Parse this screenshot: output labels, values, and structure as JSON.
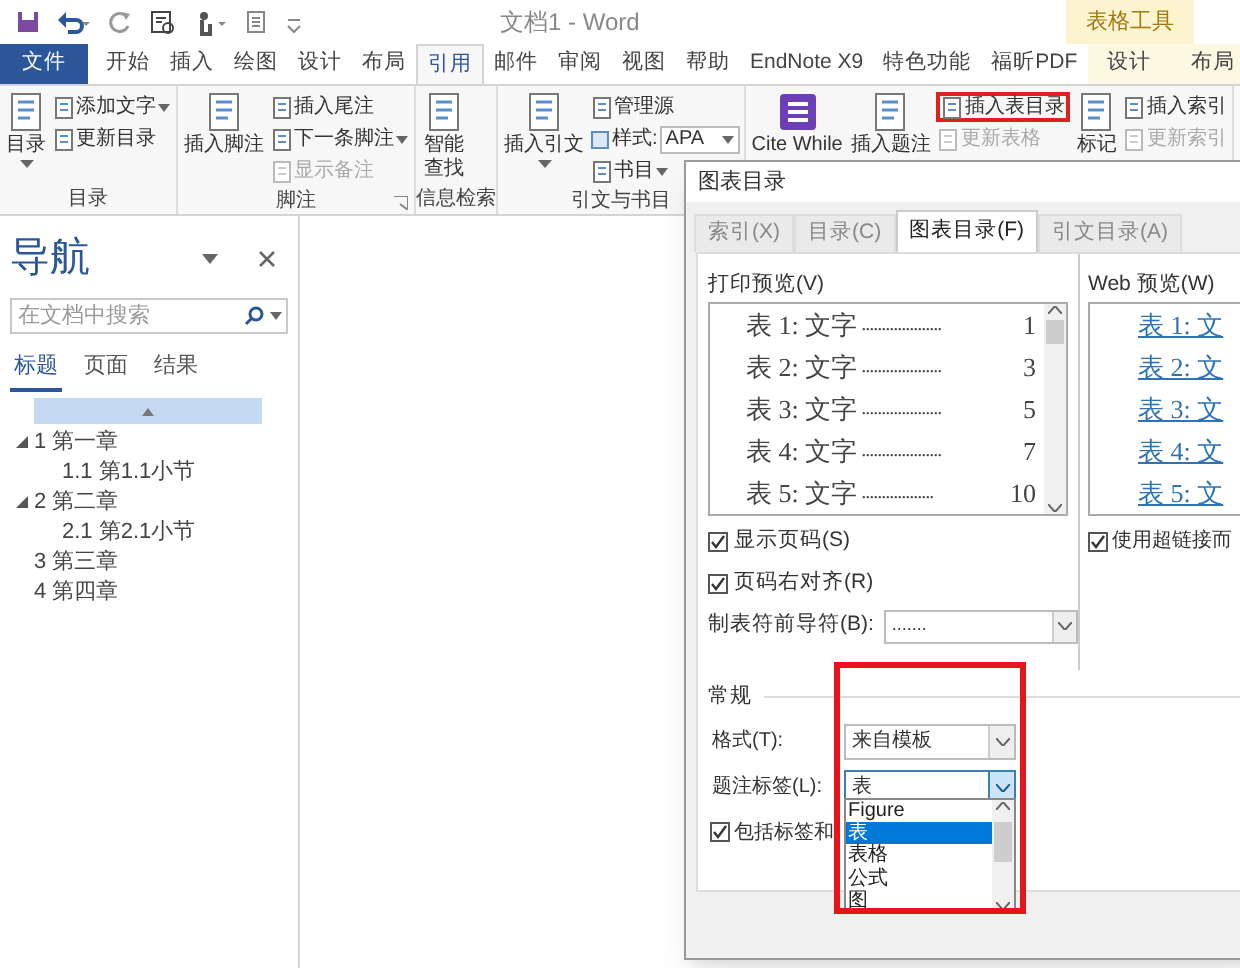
{
  "window": {
    "title": "文档1 - Word",
    "context_group": "表格工具"
  },
  "ribbon_tabs": [
    {
      "label": "文件",
      "kind": "file",
      "selected": false
    },
    {
      "label": "开始",
      "kind": "normal",
      "selected": false
    },
    {
      "label": "插入",
      "kind": "normal",
      "selected": false
    },
    {
      "label": "绘图",
      "kind": "normal",
      "selected": false
    },
    {
      "label": "设计",
      "kind": "normal",
      "selected": false
    },
    {
      "label": "布局",
      "kind": "normal",
      "selected": false
    },
    {
      "label": "引用",
      "kind": "normal",
      "selected": true
    },
    {
      "label": "邮件",
      "kind": "normal",
      "selected": false
    },
    {
      "label": "审阅",
      "kind": "normal",
      "selected": false
    },
    {
      "label": "视图",
      "kind": "normal",
      "selected": false
    },
    {
      "label": "帮助",
      "kind": "normal",
      "selected": false
    },
    {
      "label": "EndNote X9",
      "kind": "normal",
      "selected": false
    },
    {
      "label": "特色功能",
      "kind": "normal",
      "selected": false
    },
    {
      "label": "福昕PDF",
      "kind": "normal",
      "selected": false
    },
    {
      "label": "设计",
      "kind": "context",
      "selected": false
    },
    {
      "label": "布局",
      "kind": "context",
      "selected": false
    }
  ],
  "ribbon_groups": [
    {
      "label": "目录",
      "launcher": false,
      "columns": [
        [
          {
            "label": "目录",
            "kind": "large",
            "dropdown": true,
            "disabled": false,
            "highlighted": false
          }
        ],
        [
          {
            "label": "添加文字",
            "kind": "small",
            "dropdown": true,
            "disabled": false,
            "highlighted": false
          },
          {
            "label": "更新目录",
            "kind": "small",
            "dropdown": false,
            "disabled": false,
            "highlighted": false
          }
        ]
      ]
    },
    {
      "label": "脚注",
      "launcher": true,
      "columns": [
        [
          {
            "label": "插入脚注",
            "kind": "large",
            "dropdown": false,
            "disabled": false,
            "highlighted": false
          }
        ],
        [
          {
            "label": "插入尾注",
            "kind": "small",
            "dropdown": false,
            "disabled": false,
            "highlighted": false
          },
          {
            "label": "下一条脚注",
            "kind": "small",
            "dropdown": true,
            "disabled": false,
            "highlighted": false
          },
          {
            "label": "显示备注",
            "kind": "small",
            "dropdown": false,
            "disabled": true,
            "highlighted": false
          }
        ]
      ]
    },
    {
      "label": "信息检索",
      "launcher": false,
      "columns": [
        [
          {
            "label": "智能查找",
            "kind": "large",
            "dropdown": false,
            "disabled": false,
            "highlighted": false
          }
        ]
      ]
    },
    {
      "label": "引文与书目",
      "launcher": false,
      "columns": [
        [
          {
            "label": "插入引文",
            "kind": "large",
            "dropdown": true,
            "disabled": false,
            "highlighted": false
          }
        ],
        [
          {
            "label": "管理源",
            "kind": "small",
            "dropdown": false,
            "disabled": false,
            "highlighted": false
          },
          {
            "label": "样式:",
            "kind": "select",
            "value": "APA"
          },
          {
            "label": "书目",
            "kind": "small",
            "dropdown": true,
            "disabled": false,
            "highlighted": false
          }
        ]
      ]
    },
    {
      "columns": [
        [
          {
            "label": "Cite While",
            "kind": "endnote",
            "dropdown": false,
            "disabled": false,
            "highlighted": false
          }
        ],
        [
          {
            "label": "插入题注",
            "kind": "large",
            "dropdown": false,
            "disabled": false,
            "highlighted": false
          }
        ],
        [
          {
            "label": "插入表目录",
            "kind": "small",
            "dropdown": false,
            "disabled": false,
            "highlighted": true
          },
          {
            "label": "更新表格",
            "kind": "small",
            "dropdown": false,
            "disabled": true,
            "highlighted": false
          }
        ],
        [
          {
            "label": "标记",
            "kind": "large",
            "dropdown": false,
            "disabled": false,
            "highlighted": false
          }
        ],
        [
          {
            "label": "插入索引",
            "kind": "small",
            "dropdown": false,
            "disabled": false,
            "highlighted": false
          },
          {
            "label": "更新索引",
            "kind": "small",
            "dropdown": false,
            "disabled": true,
            "highlighted": false
          }
        ]
      ]
    }
  ],
  "navigation": {
    "title": "导航",
    "search": {
      "placeholder": "在文档中搜索"
    },
    "tabs": [
      {
        "label": "标题",
        "selected": true
      },
      {
        "label": "页面",
        "selected": false
      },
      {
        "label": "结果",
        "selected": false
      }
    ],
    "headings": [
      {
        "label": "1 第一章",
        "expanded": true,
        "children": [
          {
            "label": "1.1 第1.1小节"
          }
        ]
      },
      {
        "label": "2 第二章",
        "expanded": true,
        "children": [
          {
            "label": "2.1 第2.1小节"
          }
        ]
      },
      {
        "label": "3 第三章",
        "expanded": false
      },
      {
        "label": "4 第四章",
        "expanded": false
      }
    ]
  },
  "dialog": {
    "title": "图表目录",
    "tabs": [
      {
        "label": "索引(X)",
        "selected": false
      },
      {
        "label": "目录(C)",
        "selected": false
      },
      {
        "label": "图表目录(F)",
        "selected": true
      },
      {
        "label": "引文目录(A)",
        "selected": false
      }
    ],
    "print_preview": {
      "label": "打印预览(V)",
      "entries": [
        {
          "caption": "表 1: 文字",
          "leader": "....................",
          "page": "1"
        },
        {
          "caption": "表 2: 文字",
          "leader": "....................",
          "page": "3"
        },
        {
          "caption": "表 3: 文字",
          "leader": "....................",
          "page": "5"
        },
        {
          "caption": "表 4: 文字",
          "leader": "....................",
          "page": "7"
        },
        {
          "caption": "表 5: 文字",
          "leader": "..................",
          "page": "10"
        }
      ]
    },
    "print_options": [
      {
        "label": "显示页码(S)",
        "checked": true
      },
      {
        "label": "页码右对齐(R)",
        "checked": true
      }
    ],
    "tab_leader": {
      "label": "制表符前导符(B):",
      "value": "......."
    },
    "web_preview": {
      "label": "Web 预览(W)",
      "entries": [
        "表 1: 文",
        "表 2: 文",
        "表 3: 文",
        "表 4: 文",
        "表 5: 文"
      ]
    },
    "web_options": [
      {
        "label": "使用超链接而",
        "checked": true
      }
    ],
    "general": {
      "label": "常规",
      "highlighted": true,
      "format": {
        "label": "格式(T):",
        "value": "来自模板"
      },
      "caption_label": {
        "label": "题注标签(L):",
        "value": "表",
        "expanded": true,
        "options": [
          {
            "label": "Figure",
            "selected": false
          },
          {
            "label": "表",
            "selected": true
          },
          {
            "label": "表格",
            "selected": false
          },
          {
            "label": "公式",
            "selected": false
          },
          {
            "label": "图",
            "selected": false
          }
        ]
      },
      "include_label": {
        "label": "包括标签和",
        "checked": true
      }
    }
  }
}
